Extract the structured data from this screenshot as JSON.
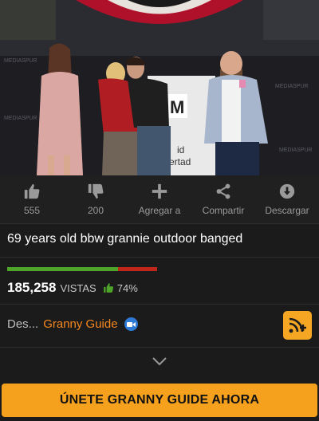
{
  "video": {
    "backdrop_text": "MEDIASPUR",
    "podium_letter": "M",
    "screen_text_1": "id",
    "screen_text_2": "ertad"
  },
  "actions": [
    {
      "icon": "thumbs-up-icon",
      "label": "555"
    },
    {
      "icon": "thumbs-down-icon",
      "label": "200"
    },
    {
      "icon": "plus-icon",
      "label": "Agregar a"
    },
    {
      "icon": "share-icon",
      "label": "Compartir"
    },
    {
      "icon": "download-icon",
      "label": "Descargar"
    }
  ],
  "video_title": "69 years old bbw grannie outdoor banged",
  "rating": {
    "percent": 74,
    "percent_label": "74%",
    "like_color": "#4ea52a",
    "dislike_color": "#c0261a"
  },
  "views": {
    "count": "185,258",
    "label": "VISTAS"
  },
  "channel": {
    "prefix": "Des...",
    "name": "Granny Guide",
    "name_color": "#f5861e",
    "badge_icon": "video-camera-icon"
  },
  "subscribe_icon": "rss-plus-icon",
  "expand_icon": "chevron-down-icon",
  "join_button": {
    "label": "ÚNETE GRANNY GUIDE AHORA",
    "color": "#f5a11e"
  }
}
